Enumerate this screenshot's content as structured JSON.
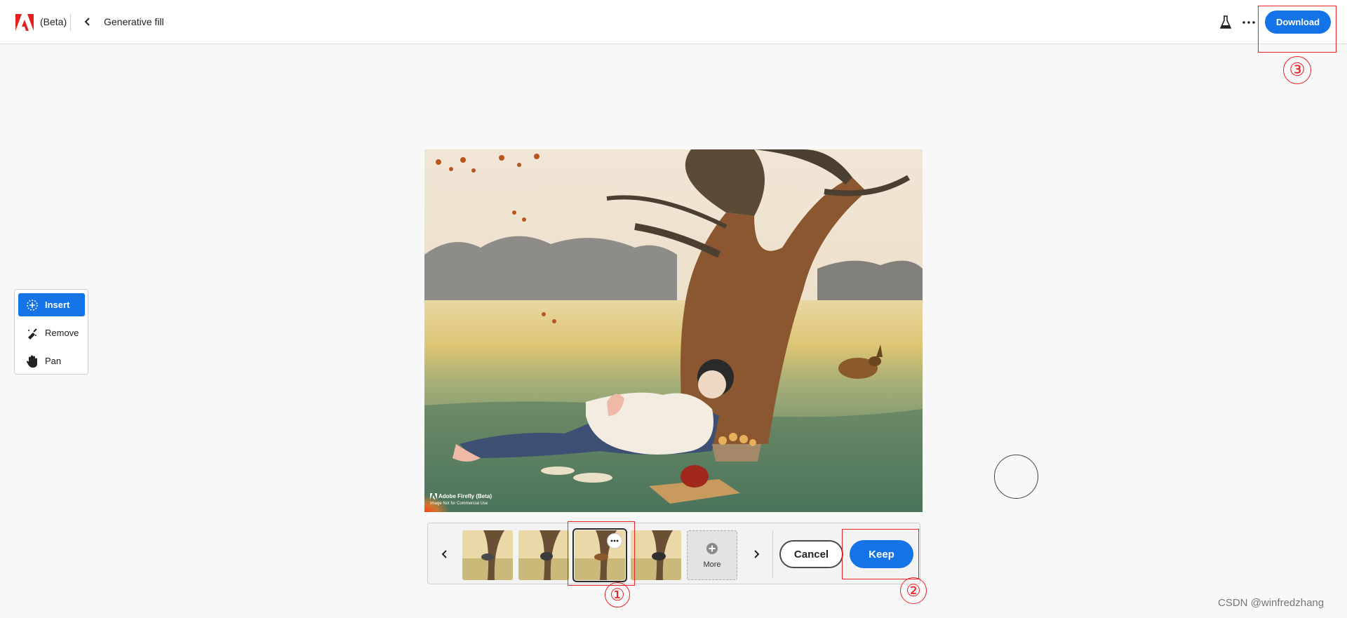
{
  "header": {
    "logo_icon": "adobe-logo-icon",
    "beta_label": "(Beta)",
    "back_icon": "chevron-left-icon",
    "title": "Generative fill",
    "labs_icon": "flask-icon",
    "more_icon": "ellipsis-icon",
    "download_label": "Download"
  },
  "tools": {
    "items": [
      {
        "label": "Insert",
        "icon": "insert-brush-icon",
        "active": true
      },
      {
        "label": "Remove",
        "icon": "remove-brush-icon",
        "active": false
      },
      {
        "label": "Pan",
        "icon": "hand-icon",
        "active": false
      }
    ]
  },
  "image": {
    "watermark_title": "Adobe Firefly (Beta)",
    "watermark_subtitle": "Image Not for Commercial Use"
  },
  "variations": {
    "prev_icon": "chevron-left-icon",
    "next_icon": "chevron-right-icon",
    "thumbnails": [
      {
        "selected": false
      },
      {
        "selected": false
      },
      {
        "selected": true
      },
      {
        "selected": false
      }
    ],
    "options_icon": "ellipsis-icon",
    "more_label": "More",
    "more_icon": "plus-circle-icon"
  },
  "actions": {
    "cancel_label": "Cancel",
    "keep_label": "Keep"
  },
  "annotations": [
    "①",
    "②",
    "③"
  ],
  "credit": "CSDN @winfredzhang",
  "colors": {
    "accent": "#1473e6",
    "annotation_red": "#e8232a",
    "background": "#f8f8f8"
  }
}
